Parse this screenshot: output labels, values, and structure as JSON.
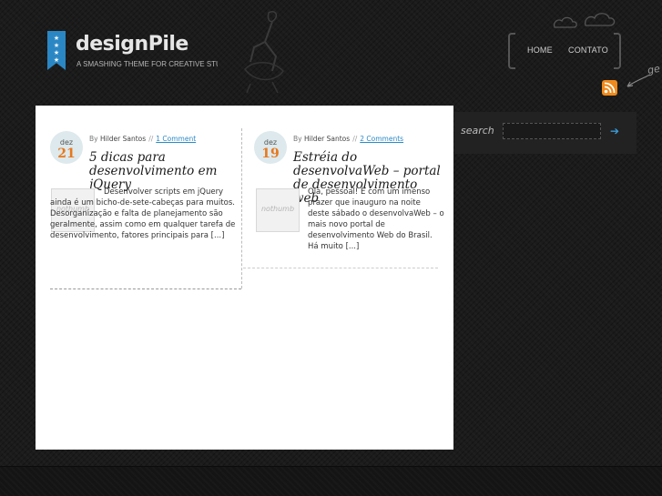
{
  "brand": {
    "title": "designPile",
    "tagline": "A SMASHING THEME FOR CREATIVE STUF",
    "corner_text": "ge",
    "ribbon_color": "#2b87c4"
  },
  "nav": {
    "items": [
      {
        "label": "HOME"
      },
      {
        "label": "CONTATO"
      }
    ]
  },
  "rss": {
    "icon": "rss-icon",
    "color": "#f08a1c"
  },
  "search": {
    "label": "search",
    "value": "",
    "placeholder": "",
    "button_icon": "arrow-right-icon"
  },
  "posts": [
    {
      "month": "dez",
      "day": "21",
      "by_label": "By",
      "author": "Hilder Santos",
      "separator": "//",
      "comments": "1 Comment",
      "title": "5 dicas para desenvolvimento em jQuery",
      "thumb_text": "nothumb",
      "excerpt": "Desenvolver scripts em jQuery ainda é um bicho-de-sete-cabeças para muitos. Desorganização e falta de planejamento são geralmente, assim como em qualquer tarefa de desenvolvimento, fatores principais para [...]"
    },
    {
      "month": "dez",
      "day": "19",
      "by_label": "By",
      "author": "Hilder Santos",
      "separator": "//",
      "comments": "2 Comments",
      "title": "Estréia do desenvolvaWeb – portal de desenvolvimento web",
      "thumb_text": "nothumb",
      "excerpt": "Olá, pessoal! É com um imenso prazer que inauguro na noite deste sábado o desenvolvaWeb – o mais novo portal de desenvolvimento Web do Brasil. Há muito [...]"
    }
  ],
  "colors": {
    "accent_orange": "#e7781d",
    "link_blue": "#2a8ac8",
    "background": "#1b1b1b"
  }
}
